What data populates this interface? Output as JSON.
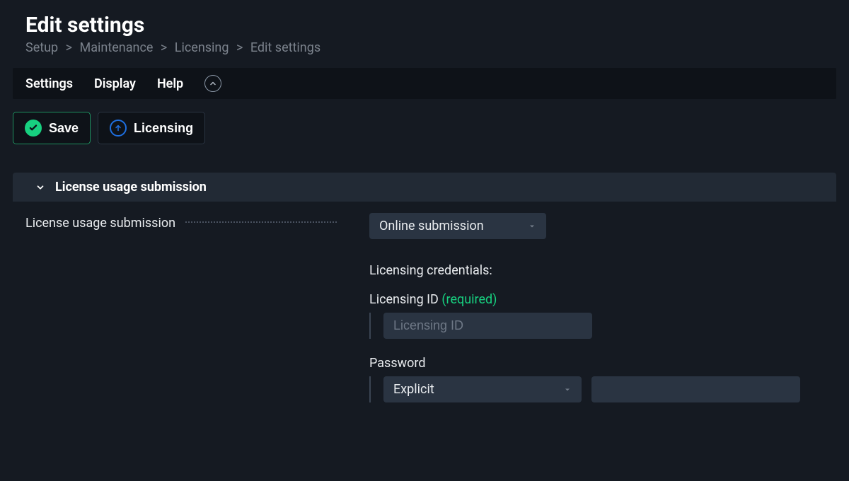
{
  "header": {
    "title": "Edit settings",
    "breadcrumb": [
      "Setup",
      "Maintenance",
      "Licensing",
      "Edit settings"
    ]
  },
  "menubar": {
    "items": [
      "Settings",
      "Display",
      "Help"
    ]
  },
  "actions": {
    "save_label": "Save",
    "licensing_label": "Licensing"
  },
  "section": {
    "title": "License usage submission",
    "row_label": "License usage submission",
    "submission_select": {
      "selected": "Online submission"
    },
    "credentials_heading": "Licensing credentials:",
    "licensing_id": {
      "label": "Licensing ID",
      "required_text": "(required)",
      "placeholder": "Licensing ID",
      "value": ""
    },
    "password": {
      "label": "Password",
      "type_selected": "Explicit",
      "value": ""
    }
  }
}
